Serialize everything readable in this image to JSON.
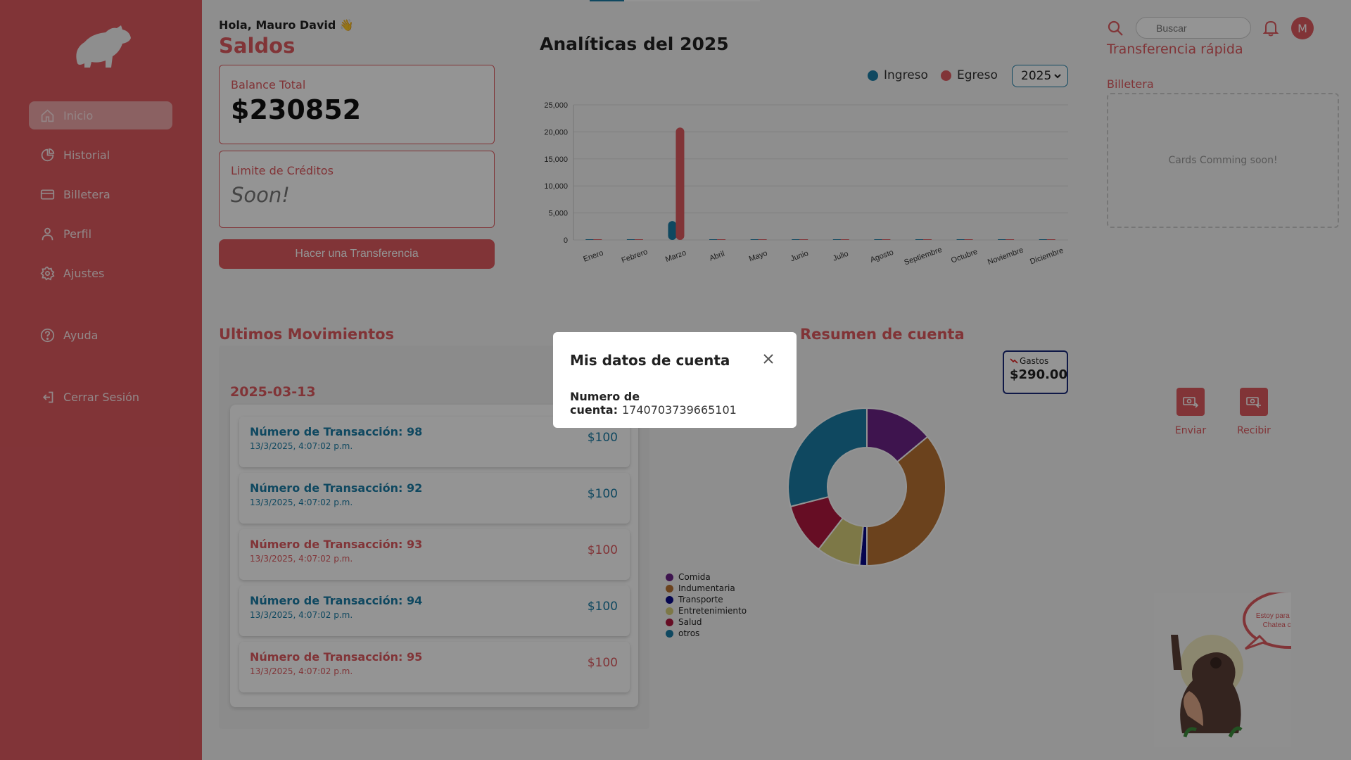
{
  "user": {
    "greeting": "Hola, Mauro David 👋",
    "avatar_letter": "M"
  },
  "sidebar": {
    "items": [
      {
        "label": "Inicio",
        "icon": "home-icon",
        "active": true
      },
      {
        "label": "Historial",
        "icon": "pie-chart-icon"
      },
      {
        "label": "Billetera",
        "icon": "credit-card-icon"
      },
      {
        "label": "Perfil",
        "icon": "user-icon"
      },
      {
        "label": "Ajustes",
        "icon": "gear-icon"
      },
      {
        "label": "Ayuda",
        "icon": "help-circle-icon"
      },
      {
        "label": "Cerrar Sesión",
        "icon": "logout-icon"
      }
    ]
  },
  "balances": {
    "title": "Saldos",
    "total_label": "Balance Total",
    "total_value": "$230852",
    "credit_label": "Limite de Créditos",
    "credit_value": "Soon!",
    "transfer_button": "Hacer una Transferencia"
  },
  "analytics": {
    "title": "Analíticas del 2025",
    "year_selected": "2025"
  },
  "chart_data": {
    "type": "bar",
    "categories": [
      "Enero",
      "Febrero",
      "Marzo",
      "Abril",
      "Mayo",
      "Junio",
      "Julio",
      "Agosto",
      "Septiembre",
      "Octubre",
      "Noviembre",
      "Diciembre"
    ],
    "series": [
      {
        "name": "Ingreso",
        "color": "#1a7ca5",
        "values": [
          0,
          0,
          3500,
          0,
          0,
          0,
          0,
          0,
          0,
          0,
          0,
          0
        ]
      },
      {
        "name": "Egreso",
        "color": "#de5a60",
        "values": [
          0,
          0,
          20800,
          0,
          0,
          0,
          0,
          0,
          0,
          0,
          0,
          0
        ]
      }
    ],
    "yticks": [
      "0",
      "5,000",
      "10,000",
      "15,000",
      "20,000",
      "25,000"
    ],
    "ylim": [
      0,
      25000
    ],
    "grid": true,
    "legend_position": "top-right"
  },
  "movements": {
    "title": "Ultimos Movimientos",
    "date": "2025-03-13",
    "items": [
      {
        "title": "Número de Transacción: 98",
        "date": "13/3/2025, 4:07:02 p.m.",
        "amount": "$100",
        "kind": "in"
      },
      {
        "title": "Número de Transacción: 92",
        "date": "13/3/2025, 4:07:02 p.m.",
        "amount": "$100",
        "kind": "in"
      },
      {
        "title": "Número de Transacción: 93",
        "date": "13/3/2025, 4:07:02 p.m.",
        "amount": "$100",
        "kind": "out"
      },
      {
        "title": "Número de Transacción: 94",
        "date": "13/3/2025, 4:07:02 p.m.",
        "amount": "$100",
        "kind": "in"
      },
      {
        "title": "Número de Transacción: 95",
        "date": "13/3/2025, 4:07:02 p.m.",
        "amount": "$100",
        "kind": "out"
      }
    ]
  },
  "summary": {
    "title": "Resumen de cuenta",
    "gastos_label": "Gastos",
    "gastos_value": "$290.00",
    "donut": [
      {
        "name": "Comida",
        "color": "#6b2387",
        "value": 14
      },
      {
        "name": "Indumentaria",
        "color": "#b87333",
        "value": 36
      },
      {
        "name": "Transporte",
        "color": "#0a0a8a",
        "value": 1.5
      },
      {
        "name": "Entretenimiento",
        "color": "#d8cf7a",
        "value": 9
      },
      {
        "name": "Salud",
        "color": "#b0173f",
        "value": 10.5
      },
      {
        "name": "otros",
        "color": "#1a7ca5",
        "value": 29
      }
    ]
  },
  "topbar": {
    "search_placeholder": "Buscar"
  },
  "right": {
    "quick_transfer": "Transferencia rápida",
    "wallet_title": "Billetera",
    "wallet_placeholder": "Cards Comming soon!",
    "send_label": "Enviar",
    "receive_label": "Recibir",
    "helper_text_1": "Estoy para ayudarte.",
    "helper_text_2": "Chatea conmigo"
  },
  "modal": {
    "title": "Mis datos de cuenta",
    "account_label": "Numero de cuenta:",
    "account_value": "1740703739665101"
  },
  "colors": {
    "brand": "#de5a60",
    "accent": "#1a7ca5"
  }
}
